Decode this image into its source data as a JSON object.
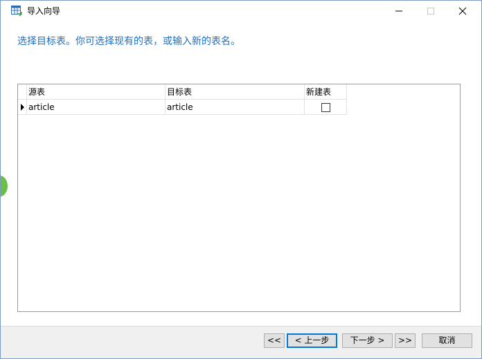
{
  "window": {
    "title": "导入向导",
    "icon": "table-import-icon",
    "controls": {
      "minimize_icon": "minimize-icon",
      "maximize_icon": "maximize-icon",
      "close_icon": "close-icon"
    }
  },
  "instruction": "选择目标表。你可选择现有的表，或输入新的表名。",
  "grid": {
    "columns": [
      "源表",
      "目标表",
      "新建表"
    ],
    "rows": [
      {
        "source": "article",
        "target": "article",
        "new_table": false,
        "current": true
      }
    ]
  },
  "footer": {
    "first_label": "<<",
    "prev_label": "< 上一步",
    "next_label": "下一步 >",
    "last_label": ">>",
    "cancel_label": "取消"
  },
  "colors": {
    "instruction_text": "#1f6fbf",
    "footer_bg": "#f0f0f0",
    "focus_border": "#0078d7"
  }
}
